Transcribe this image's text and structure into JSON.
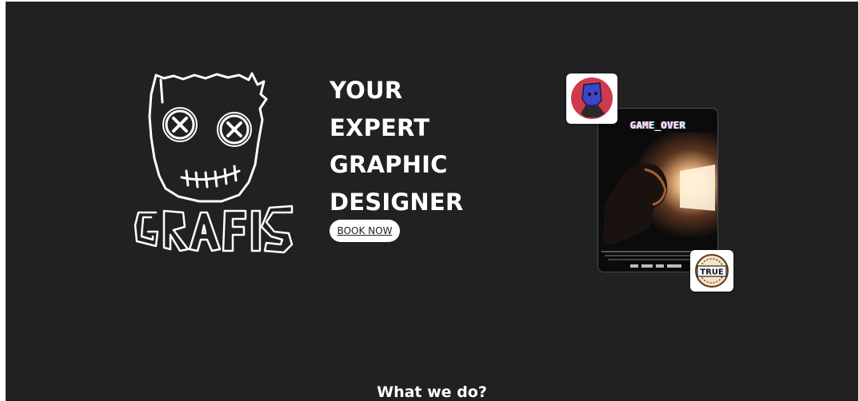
{
  "hero": {
    "title_lines": [
      "YOUR",
      "EXPERT",
      "GRAPHIC",
      "DESIGNER"
    ],
    "book_label": "BOOK NOW"
  },
  "logo": {
    "brand_text": "GRAFIS",
    "icon": "stitched-face-logo"
  },
  "poster": {
    "title": "GAME_OVER"
  },
  "badges": {
    "avatar_icon": "character-avatar-icon",
    "true_logo_text": "TRUE"
  },
  "sections": {
    "what_we_do_heading": "What we do?"
  },
  "colors": {
    "background": "#212121",
    "text": "#ffffff",
    "button_bg": "#ffffff",
    "avatar_bg": "#cf3a4e",
    "avatar_figure": "#3a47c9"
  }
}
